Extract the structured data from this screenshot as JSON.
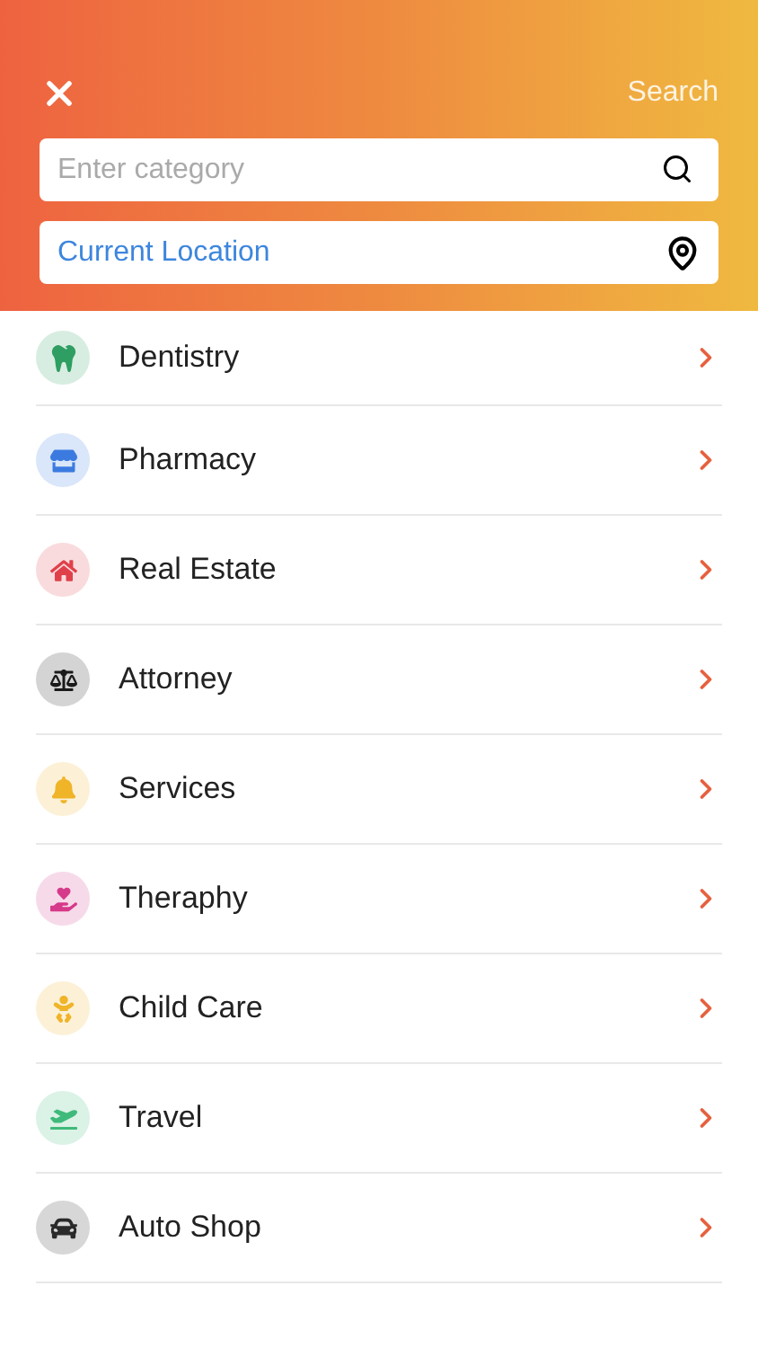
{
  "header": {
    "action": "Search",
    "category_field": {
      "placeholder": "Enter category"
    },
    "location_field": {
      "value": "Current Location"
    }
  },
  "categories": [
    {
      "label": "Dentistry",
      "kind": "tooth",
      "color": "#2e9e62"
    },
    {
      "label": "Pharmacy",
      "kind": "store",
      "color": "#3b7be0"
    },
    {
      "label": "Real Estate",
      "kind": "house",
      "color": "#e0404a"
    },
    {
      "label": "Attorney",
      "kind": "scale",
      "color": "#1a1a1a"
    },
    {
      "label": "Services",
      "kind": "bell",
      "color": "#f0b429"
    },
    {
      "label": "Theraphy",
      "kind": "massage",
      "color": "#d63a8a"
    },
    {
      "label": "Child Care",
      "kind": "baby",
      "color": "#f0b429"
    },
    {
      "label": "Travel",
      "kind": "plane",
      "color": "#3fba7a"
    },
    {
      "label": "Auto Shop",
      "kind": "car",
      "color": "#2a2a2a"
    }
  ]
}
